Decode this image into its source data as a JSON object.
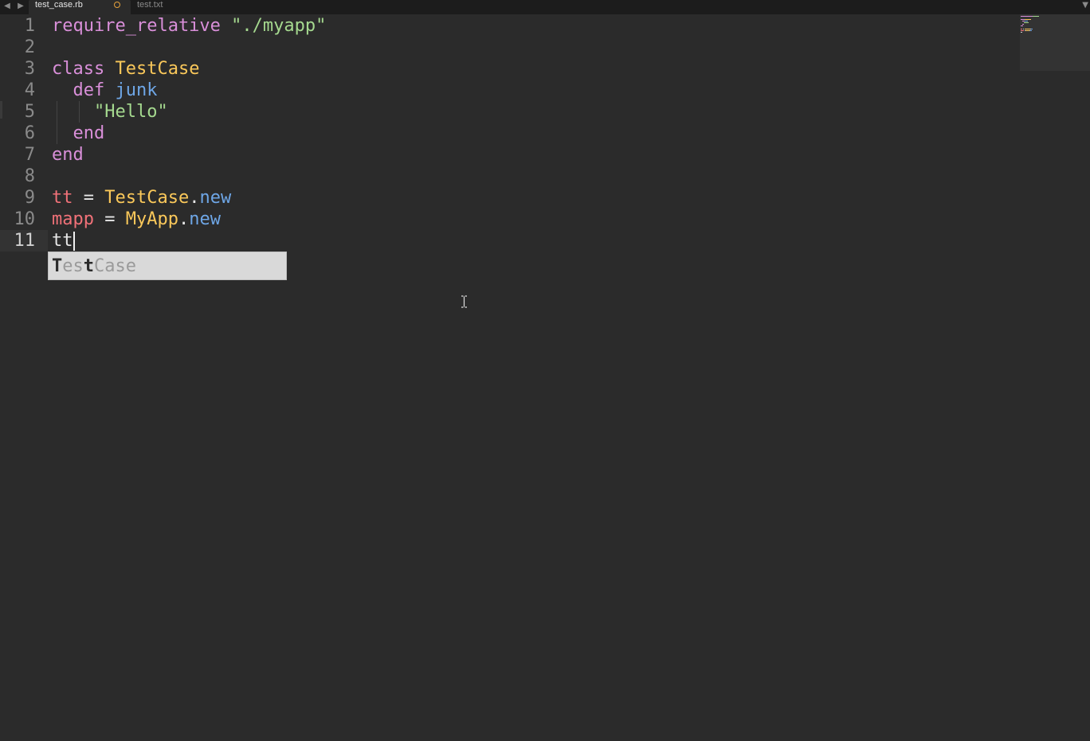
{
  "tabbar": {
    "back_icon": "◀",
    "forward_icon": "▶",
    "tabs": [
      {
        "label": "test_case.rb",
        "active": true,
        "dirty": true
      },
      {
        "label": "test.txt",
        "active": false,
        "dirty": false
      }
    ],
    "overflow_icon": "▼"
  },
  "editor": {
    "line_numbers": [
      "1",
      "2",
      "3",
      "4",
      "5",
      "6",
      "7",
      "8",
      "9",
      "10",
      "11"
    ],
    "current_line": "11",
    "lines": [
      {
        "tokens": [
          {
            "t": "require_relative ",
            "c": "kw"
          },
          {
            "t": "\"./myapp\"",
            "c": "str"
          }
        ]
      },
      {
        "tokens": []
      },
      {
        "tokens": [
          {
            "t": "class ",
            "c": "kw"
          },
          {
            "t": "TestCase",
            "c": "const"
          }
        ]
      },
      {
        "tokens": [
          {
            "t": "  def ",
            "c": "kw"
          },
          {
            "t": "junk",
            "c": "fn"
          }
        ]
      },
      {
        "tokens": [
          {
            "t": "    \"Hello\"",
            "c": "str"
          }
        ]
      },
      {
        "tokens": [
          {
            "t": "  end",
            "c": "kw"
          }
        ]
      },
      {
        "tokens": [
          {
            "t": "end",
            "c": "kw"
          }
        ]
      },
      {
        "tokens": []
      },
      {
        "tokens": [
          {
            "t": "tt",
            "c": "var"
          },
          {
            "t": " = ",
            "c": "plain"
          },
          {
            "t": "TestCase",
            "c": "const"
          },
          {
            "t": ".",
            "c": "plain"
          },
          {
            "t": "new",
            "c": "fn"
          }
        ]
      },
      {
        "tokens": [
          {
            "t": "mapp",
            "c": "var"
          },
          {
            "t": " = ",
            "c": "plain"
          },
          {
            "t": "MyApp",
            "c": "const"
          },
          {
            "t": ".",
            "c": "plain"
          },
          {
            "t": "new",
            "c": "fn"
          }
        ]
      },
      {
        "tokens": [
          {
            "t": "tt",
            "c": "plain"
          }
        ]
      }
    ]
  },
  "autocomplete": {
    "segments": [
      {
        "t": "T",
        "match": true
      },
      {
        "t": "es",
        "match": false
      },
      {
        "t": "t",
        "match": true
      },
      {
        "t": "Case",
        "match": false
      }
    ]
  },
  "colors": {
    "background": "#2b2b2b",
    "keyword": "#d98fd9",
    "constant": "#fac85a",
    "string": "#a5d98f",
    "function": "#6ea6e6",
    "variable": "#f07178",
    "dirty_indicator": "#e6a23c"
  }
}
